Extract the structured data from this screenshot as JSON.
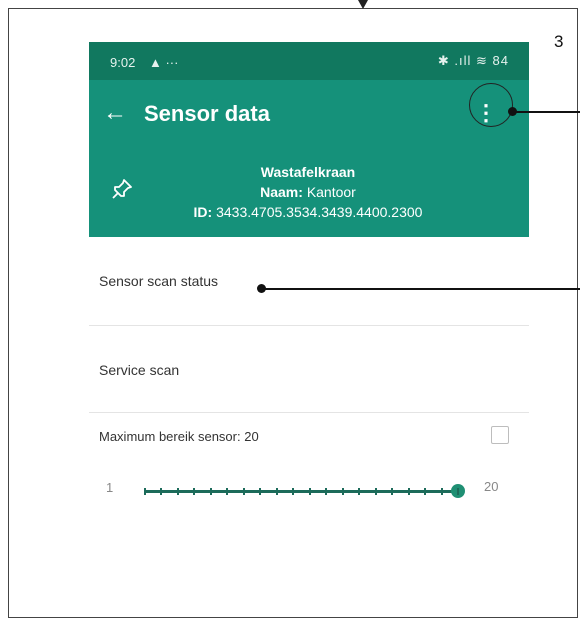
{
  "step_number": "3",
  "statusbar": {
    "time": "9:02",
    "notification_icons": "▲ ···",
    "system_icons": "✱ .ıll ≋ 84",
    "battery": "84"
  },
  "appbar": {
    "title": "Sensor data",
    "device_name": "Wastafelkraan",
    "naam_label": "Naam:",
    "naam_value": "Kantoor",
    "id_label": "ID:",
    "id_value": "3433.4705.3534.3439.4400.2300"
  },
  "icons": {
    "back": "arrow-left-icon",
    "menu": "more-vertical-icon",
    "pin": "pin-icon"
  },
  "rows": {
    "sensor_scan_status": "Sensor scan status",
    "service_scan": "Service scan"
  },
  "range": {
    "label": "Maximum bereik sensor: 20",
    "min_label": "1",
    "max_label": "20",
    "min": 1,
    "max": 20,
    "value": 20,
    "checked": false
  },
  "colors": {
    "statusbar": "#11785f",
    "appbar": "#15917a",
    "slider": "#1c6b5a"
  }
}
